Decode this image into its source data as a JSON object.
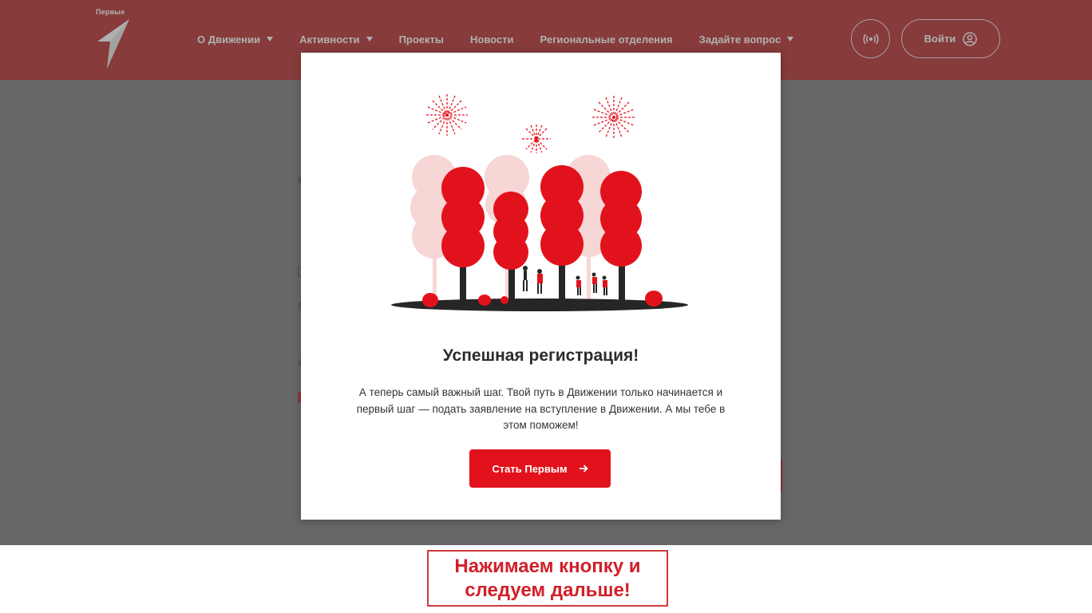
{
  "header": {
    "logo_text": "Первые",
    "background": "#b42a2a",
    "nav": [
      {
        "label": "О Движении",
        "dropdown": true
      },
      {
        "label": "Активности",
        "dropdown": true
      },
      {
        "label": "Проекты",
        "dropdown": false
      },
      {
        "label": "Новости",
        "dropdown": false
      },
      {
        "label": "Региональные отделения",
        "dropdown": false
      },
      {
        "label": "Задайте вопрос",
        "dropdown": true
      }
    ],
    "broadcast_icon": "broadcast-icon",
    "login_label": "Войти",
    "login_icon": "user-circle-icon"
  },
  "modal": {
    "illustration": "celebration-trees-fireworks-illustration",
    "title": "Успешная регистрация!",
    "text": "А теперь самый важный шаг. Твой путь в Движении только начинается и первый шаг — подать заявление на вступление в Движении. А мы тебе в этом поможем!",
    "button_label": "Стать Первым",
    "button_icon": "arrow-right-icon",
    "accent": "#e2121c"
  },
  "caption": {
    "line1": "Нажимаем кнопку и",
    "line2": "следуем дальше!",
    "color": "#d21f2a"
  }
}
